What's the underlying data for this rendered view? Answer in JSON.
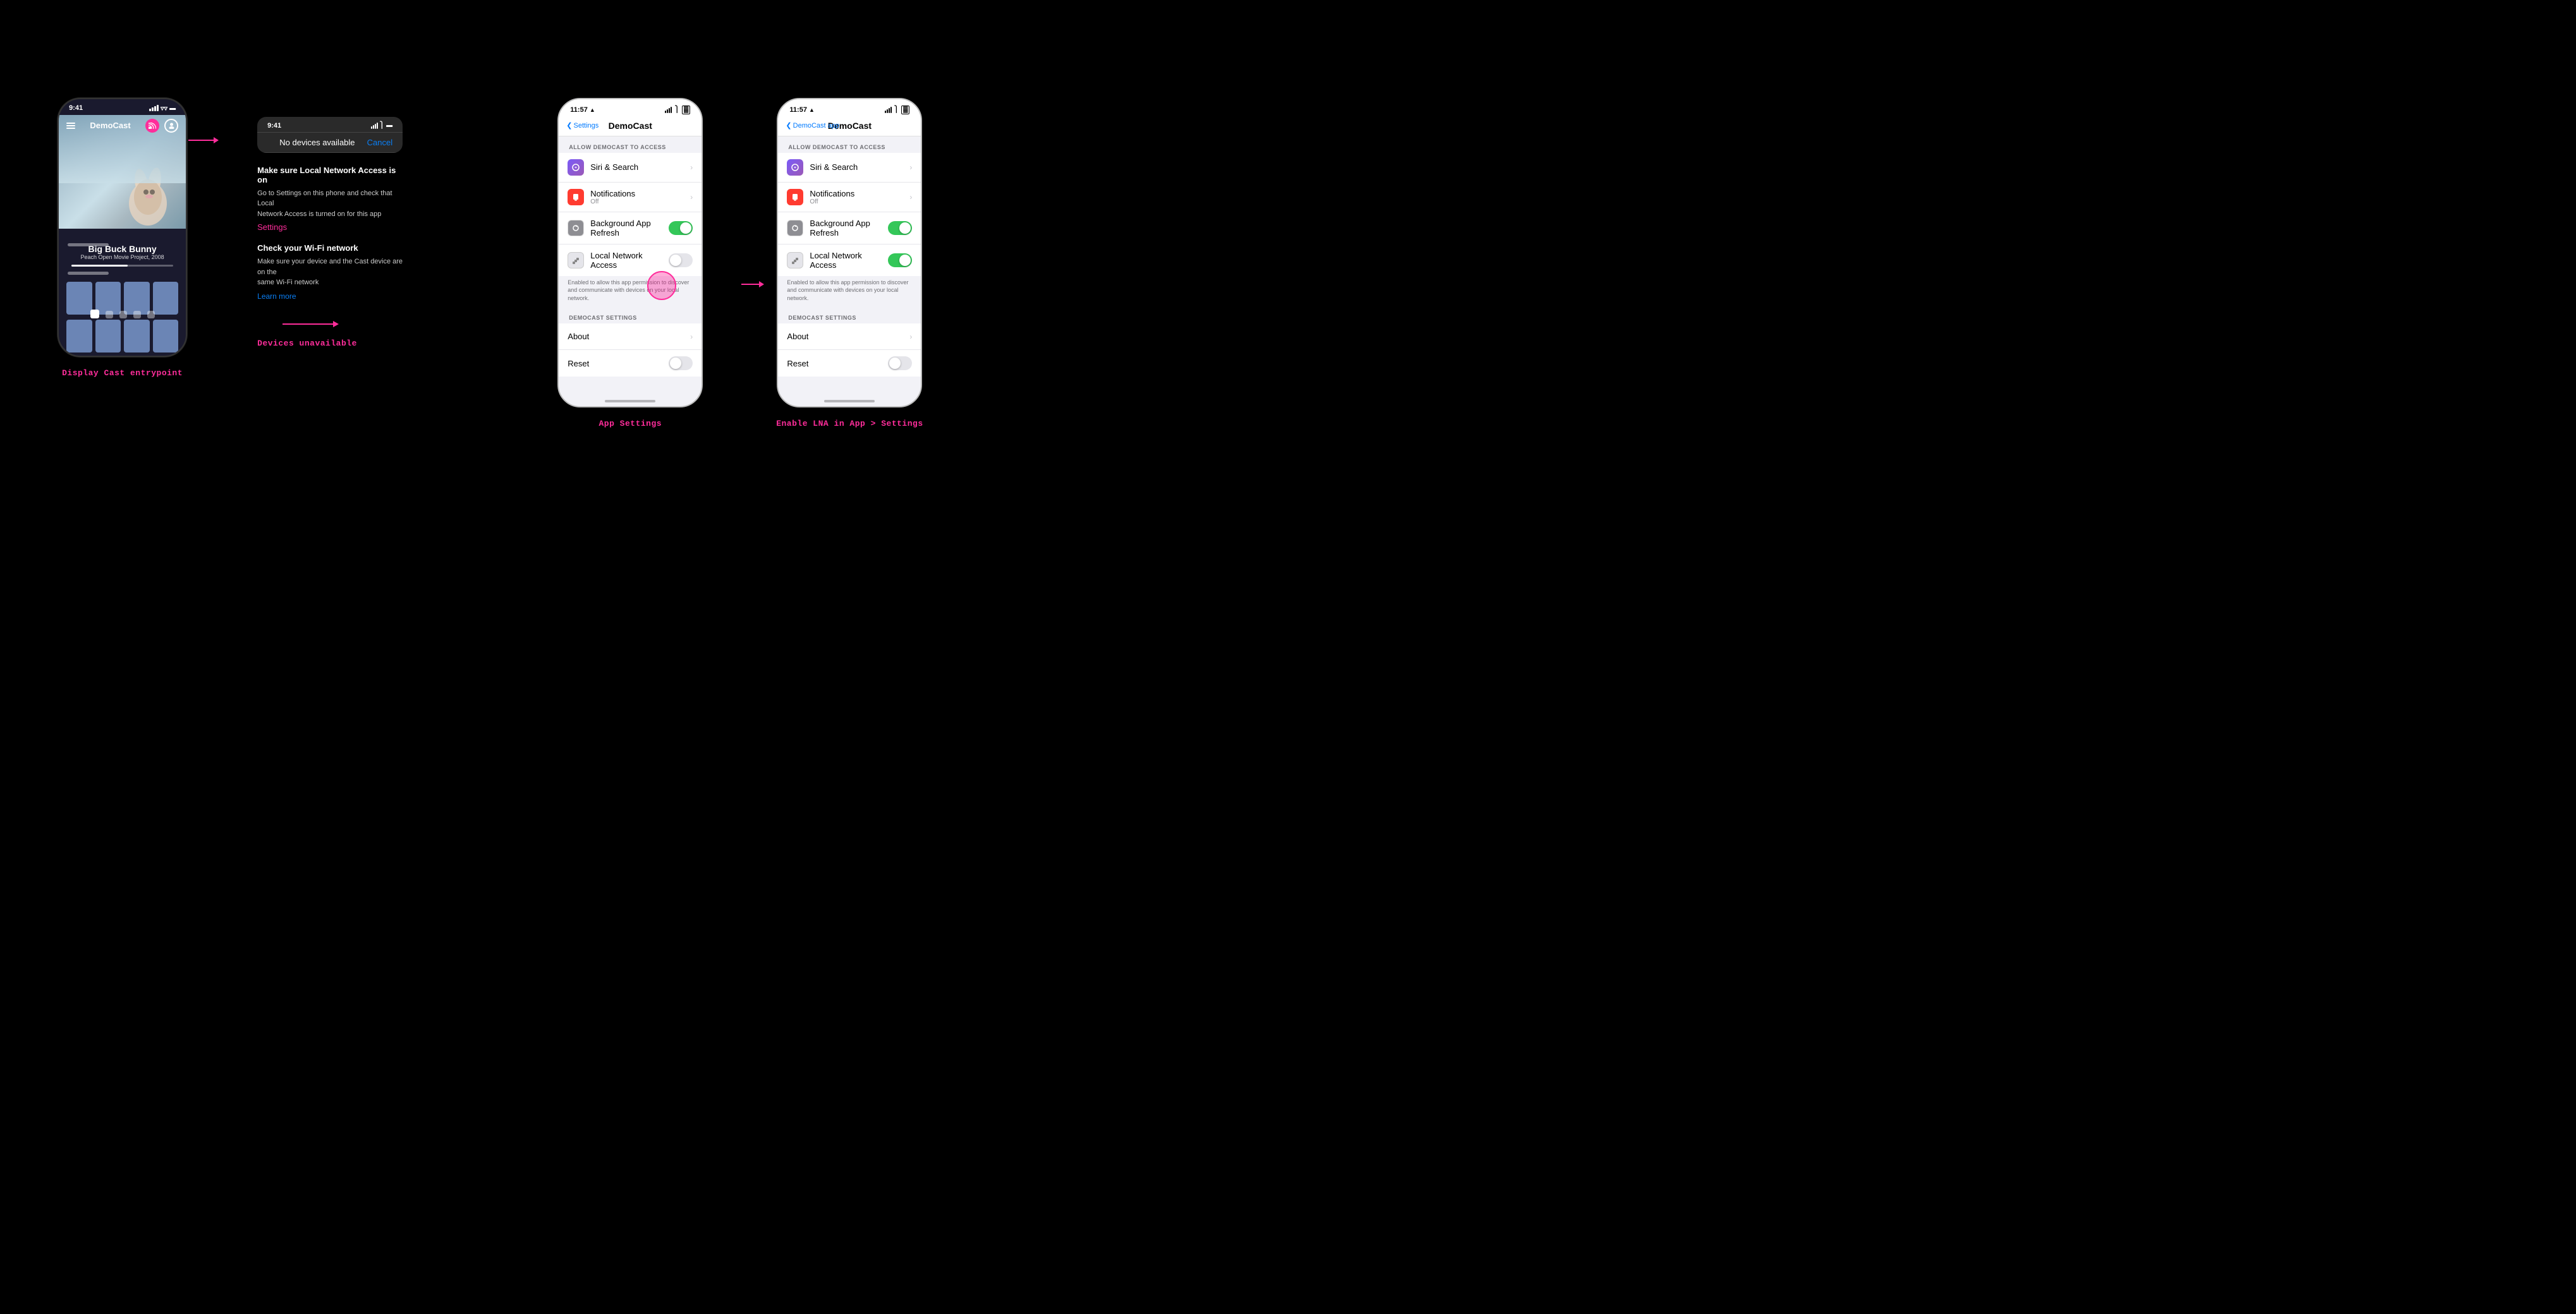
{
  "section1": {
    "label": "Display Cast entrypoint",
    "phone": {
      "time": "9:41",
      "app_title": "DemoCast",
      "video_title": "Big Buck Bunny",
      "video_subtitle": "Peach Open Movie Project, 2008"
    }
  },
  "section2": {
    "label": "Devices unavailable",
    "phone_time": "9:41",
    "dialog": {
      "no_devices_text": "No devices available",
      "cancel_label": "Cancel"
    },
    "help1_title": "Make sure Local Network Access is on",
    "help1_body": "Go to Settings on this phone and check that Local\nNetwork Access is turned on for this app",
    "help1_link": "Settings",
    "help2_title": "Check your Wi-Fi network",
    "help2_body": "Make sure your device and the Cast device are on the\nsame Wi-Fi network",
    "help2_link": "Learn more"
  },
  "section3": {
    "label": "App Settings",
    "phone": {
      "time": "11:57",
      "back_label": "Settings",
      "title": "DemoCast",
      "section_header": "ALLOW DEMOCAST TO ACCESS",
      "items": [
        {
          "icon": "purple",
          "label": "Siri & Search",
          "value": "",
          "type": "chevron"
        },
        {
          "icon": "red",
          "label": "Notifications",
          "sublabel": "Off",
          "type": "chevron"
        },
        {
          "icon": "gray",
          "label": "Background App Refresh",
          "type": "toggle",
          "on": true
        },
        {
          "icon": "gray2",
          "label": "Local Network Access",
          "type": "toggle",
          "on": false
        }
      ],
      "lna_description": "Enabled to allow this app permission to discover and communicate with devices on your local network.",
      "section2_header": "DEMOCAST SETTINGS",
      "section2_items": [
        {
          "label": "About",
          "type": "chevron"
        },
        {
          "label": "Reset",
          "type": "toggle",
          "on": false
        }
      ]
    }
  },
  "section4": {
    "label": "Enable LNA in App > Settings",
    "phone": {
      "time": "11:57",
      "back_label": "DemoCast app",
      "title": "DemoCast",
      "section_header": "ALLOW DEMOCAST TO ACCESS",
      "items": [
        {
          "icon": "purple",
          "label": "Siri & Search",
          "value": "",
          "type": "chevron"
        },
        {
          "icon": "red",
          "label": "Notifications",
          "sublabel": "Off",
          "type": "chevron"
        },
        {
          "icon": "gray",
          "label": "Background App Refresh",
          "type": "toggle",
          "on": true
        },
        {
          "icon": "gray2",
          "label": "Local Network Access",
          "type": "toggle",
          "on": true
        }
      ],
      "lna_description": "Enabled to allow this app permission to discover and communicate with devices on your local network.",
      "section2_header": "DEMOCAST SETTINGS",
      "section2_items": [
        {
          "label": "About",
          "type": "chevron"
        },
        {
          "label": "Reset",
          "type": "toggle",
          "on": false
        }
      ]
    }
  },
  "colors": {
    "pink": "#ff2d9b",
    "blue": "#007aff",
    "green": "#34c759"
  }
}
